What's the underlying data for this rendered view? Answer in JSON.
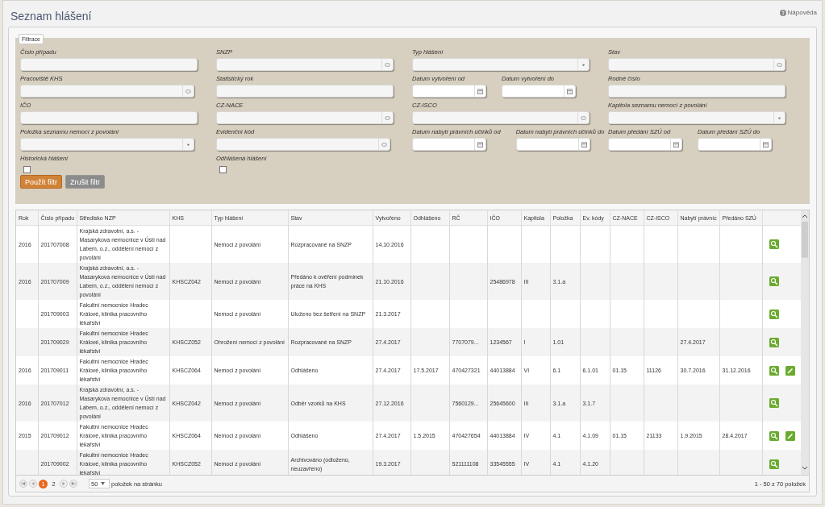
{
  "page": {
    "title": "Seznam hlášení",
    "help": "Nápověda"
  },
  "filter": {
    "legend": "Filtrace",
    "rows": [
      [
        [
          {
            "label": "Číslo případu",
            "kind": "text"
          }
        ],
        [
          {
            "label": "SNZP",
            "kind": "lookup"
          }
        ],
        [
          {
            "label": "Typ hlášení",
            "kind": "select"
          }
        ],
        [
          {
            "label": "Stav",
            "kind": "lookup"
          }
        ]
      ],
      [
        [
          {
            "label": "Pracoviště KHS",
            "kind": "lookup"
          }
        ],
        [
          {
            "label": "Statistický rok",
            "kind": "text"
          }
        ],
        [
          {
            "label": "Datum vytvoření od",
            "kind": "date"
          },
          {
            "label": "Datum vytvoření do",
            "kind": "date"
          }
        ],
        [
          {
            "label": "Rodné číslo",
            "kind": "text"
          }
        ]
      ],
      [
        [
          {
            "label": "IČO",
            "kind": "text"
          }
        ],
        [
          {
            "label": "CZ-NACE",
            "kind": "lookup"
          }
        ],
        [
          {
            "label": "CZ-ISCO",
            "kind": "lookup"
          }
        ],
        [
          {
            "label": "Kapitola seznamu nemocí z povolání",
            "kind": "select"
          }
        ]
      ],
      [
        [
          {
            "label": "Položka seznamu nemocí z povolání",
            "kind": "select"
          }
        ],
        [
          {
            "label": "Evidenční kód",
            "kind": "lookup"
          }
        ],
        [
          {
            "label": "Datum nabytí právních účinků od",
            "kind": "date"
          },
          {
            "label": "Datum nabytí právních účinků do",
            "kind": "date"
          }
        ],
        [
          {
            "label": "Datum předání SZÚ od",
            "kind": "date"
          },
          {
            "label": "Datum předání SZÚ do",
            "kind": "date"
          }
        ]
      ],
      [
        [
          {
            "label": "Historická hlášení",
            "kind": "checkbox",
            "checked": false
          }
        ],
        [
          {
            "label": "Odhlášená hlášení",
            "kind": "checkbox",
            "checked": false
          }
        ],
        [],
        []
      ]
    ],
    "buttons": [
      {
        "label": "Použít filtr",
        "kind": "primary"
      },
      {
        "label": "Zrušit filtr",
        "kind": "secondary"
      }
    ]
  },
  "table": {
    "columns": [
      "Rok",
      "Číslo případu",
      "Středisko NZP",
      "KHS",
      "Typ hlášení",
      "Stav",
      "Vytvořeno",
      "Odhlášeno",
      "RČ",
      "IČO",
      "Kapitola",
      "Položka",
      "Ev. kódy",
      "CZ-NACE",
      "CZ-ISCO",
      "Nabytí právníc",
      "Předáno SZÚ"
    ],
    "rows": [
      {
        "cells": [
          "2016",
          "201707008",
          "Krajská zdravotní, a.s. - Masarykova nemocnice v Ústí nad Labem, o.z., oddělení nemocí z povolání",
          null,
          "Nemoci z povolání",
          "Rozpracované na SNZP",
          "14.10.2016",
          null,
          null,
          null,
          null,
          null,
          null,
          null,
          null,
          null,
          null
        ],
        "actions": [
          {
            "kind": "view"
          }
        ]
      },
      {
        "cells": [
          "2016",
          "201707009",
          "Krajská zdravotní, a.s. - Masarykova nemocnice v Ústí nad Labem, o.z., oddělení nemocí z povolání",
          "KHSCZ042",
          "Nemoci z povolání",
          "Předáno k ověření podmínek práce na KHS",
          "21.10.2016",
          null,
          null,
          "25486978",
          "III",
          "3.1.a",
          null,
          null,
          null,
          null,
          null
        ],
        "actions": [
          {
            "kind": "view"
          }
        ]
      },
      {
        "cells": [
          null,
          "201709003",
          "Fakultní nemocnice Hradec Králové, klinika pracovního lékařství",
          null,
          "Nemoci z povolání",
          "Uloženo bez šetření na SNZP",
          "21.3.2017",
          null,
          null,
          null,
          null,
          null,
          null,
          null,
          null,
          null,
          null
        ],
        "actions": [
          {
            "kind": "view"
          }
        ]
      },
      {
        "cells": [
          null,
          "201709029",
          "Fakultní nemocnice Hradec Králové, klinika pracovního lékařství",
          "KHSCZ052",
          "Ohrožení nemocí z povolání",
          "Rozpracované na SNZP",
          "27.4.2017",
          null,
          "7707079...",
          "1234567",
          "I",
          "1.01",
          null,
          null,
          null,
          "27.4.2017",
          null
        ],
        "actions": [
          {
            "kind": "view"
          }
        ]
      },
      {
        "cells": [
          "2016",
          "201709011",
          "Fakultní nemocnice Hradec Králové, klinika pracovního lékařství",
          "KHSCZ064",
          "Nemoci z povolání",
          "Odhlášeno",
          "27.4.2017",
          "17.5.2017",
          "470427321",
          "44013884",
          "VI",
          "6.1",
          "6.1.01",
          "01.15",
          "11126",
          "30.7.2016",
          "31.12.2016"
        ],
        "actions": [
          {
            "kind": "view"
          },
          {
            "kind": "edit"
          }
        ]
      },
      {
        "cells": [
          "2016",
          "201707012",
          "Krajská zdravotní, a.s. - Masarykova nemocnice v Ústí nad Labem, o.z., oddělení nemocí z povolání",
          "KHSCZ042",
          "Nemoci z povolání",
          "Odběr vzorků na KHS",
          "27.12.2016",
          null,
          "7560129...",
          "25645600",
          "III",
          "3.1.a",
          "3.1.7",
          null,
          null,
          null,
          null
        ],
        "actions": [
          {
            "kind": "view"
          }
        ]
      },
      {
        "cells": [
          "2015",
          "201709012",
          "Fakultní nemocnice Hradec Králové, klinika pracovního lékařství",
          "KHSCZ064",
          "Nemoci z povolání",
          "Odhlášeno",
          "27.4.2017",
          "1.5.2015",
          "470427654",
          "44013884",
          "IV",
          "4.1",
          "4.1.09",
          "01.15",
          "21133",
          "1.9.2015",
          "28.4.2017"
        ],
        "actions": [
          {
            "kind": "view"
          },
          {
            "kind": "edit"
          }
        ]
      },
      {
        "cells": [
          null,
          "201709002",
          "Fakultní nemocnice Hradec Králové, klinika pracovního lékařství",
          "KHSCZ052",
          "Nemoci z povolání",
          "Archivováno (odloženo, neuzavřeno)",
          "19.3.2017",
          null,
          "521111108",
          "33545555",
          "IV",
          "4.1",
          "4.1.20",
          null,
          null,
          null,
          null
        ],
        "actions": [
          {
            "kind": "view"
          }
        ]
      }
    ]
  },
  "pager": {
    "pages": [
      {
        "label": "1",
        "selected": true
      },
      {
        "label": "2",
        "selected": false
      }
    ],
    "page_size": "50",
    "page_size_label": "položek na stránku",
    "summary": "1 - 50 z 70 položek"
  }
}
